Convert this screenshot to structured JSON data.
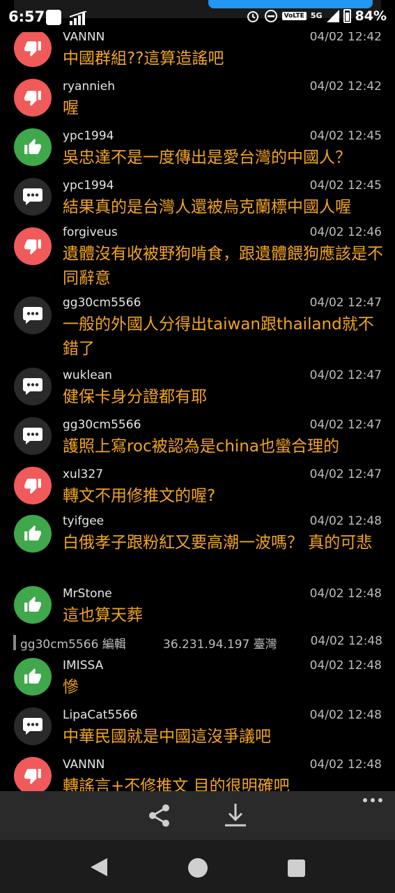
{
  "status_bar": {
    "time": "6:57",
    "volte": "VoLTE",
    "network": "5G",
    "battery": "84%"
  },
  "comments": [
    {
      "type": "down",
      "icon": "thumbs-down-icon",
      "user": "VANNN",
      "time": "04/02 12:42",
      "text": "中國群組??這算造謠吧"
    },
    {
      "type": "down",
      "icon": "thumbs-down-icon",
      "user": "ryannieh",
      "time": "04/02 12:42",
      "text": "喔"
    },
    {
      "type": "up",
      "icon": "thumbs-up-icon",
      "user": "ypc1994",
      "time": "04/02 12:45",
      "text": "吳忠達不是一度傳出是愛台灣的中國人？"
    },
    {
      "type": "neutral",
      "icon": "speech-bubble-icon",
      "user": "ypc1994",
      "time": "04/02 12:45",
      "text": "結果真的是台灣人還被烏克蘭標中國人喔"
    },
    {
      "type": "down",
      "icon": "thumbs-down-icon",
      "user": "forgiveus",
      "time": "04/02 12:46",
      "text": "遺體沒有收被野狗啃食，跟遺體餵狗應該是不同辭意"
    },
    {
      "type": "neutral",
      "icon": "speech-bubble-icon",
      "user": "gg30cm5566",
      "time": "04/02 12:47",
      "text": "一般的外國人分得出taiwan跟thailand就不錯了"
    },
    {
      "type": "neutral",
      "icon": "speech-bubble-icon",
      "user": "wuklean",
      "time": "04/02 12:47",
      "text": "健保卡身分證都有耶"
    },
    {
      "type": "neutral",
      "icon": "speech-bubble-icon",
      "user": "gg30cm5566",
      "time": "04/02 12:47",
      "text": "護照上寫roc被認為是china也蠻合理的"
    },
    {
      "type": "down",
      "icon": "thumbs-down-icon",
      "user": "xul327",
      "time": "04/02 12:47",
      "text": "轉文不用修推文的喔?"
    },
    {
      "type": "up",
      "icon": "thumbs-up-icon",
      "user": "tyifgee",
      "time": "04/02 12:48",
      "text": "白俄孝子跟粉紅又要高潮一波嗎？ 真的可悲"
    },
    {
      "type": "up",
      "icon": "thumbs-up-icon",
      "user": "MrStone",
      "time": "04/02 12:48",
      "text": "這也算天葬"
    },
    {
      "type": "up",
      "icon": "thumbs-up-icon",
      "user": "IMISSA",
      "time": "04/02 12:48",
      "text": "慘"
    },
    {
      "type": "neutral",
      "icon": "speech-bubble-icon",
      "user": "LipaCat5566",
      "time": "04/02 12:48",
      "text": "中華民國就是中國這沒爭議吧"
    },
    {
      "type": "down",
      "icon": "thumbs-down-icon",
      "user": "VANNN",
      "time": "04/02 12:48",
      "text": "轉謠言+不修推文 目的很明確吧"
    }
  ],
  "edit_record": {
    "user": "gg30cm5566 編輯",
    "ip": "36.231.94.197 臺灣",
    "time": "04/02 12:48"
  },
  "toolbar": {
    "share_icon": "share-icon",
    "download_icon": "download-icon",
    "more_icon": "more-dots-icon"
  },
  "colors": {
    "upvote": "#3fa84a",
    "downvote": "#f05a5a",
    "neutral": "#2a2a2a",
    "comment_text": "#f2a51f",
    "background": "#000000"
  }
}
